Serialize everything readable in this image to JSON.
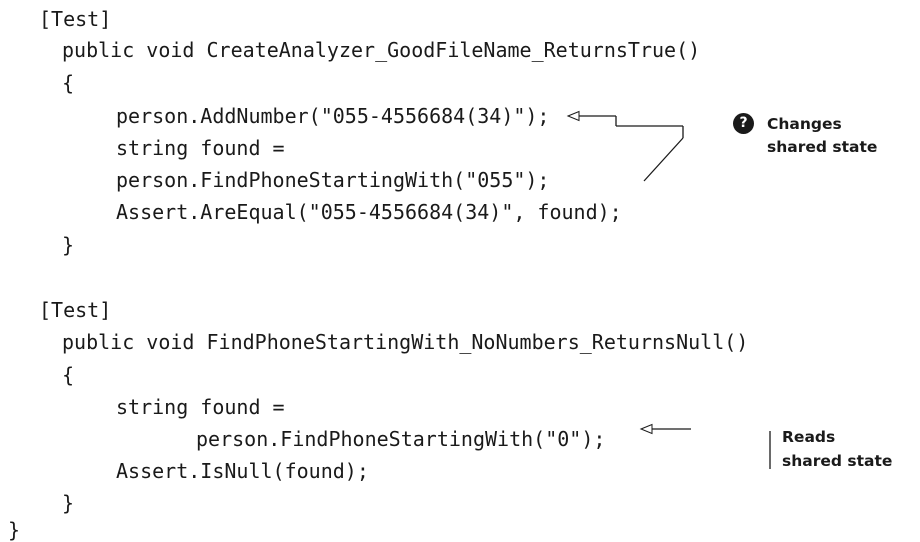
{
  "code": {
    "lines": [
      "[Test]",
      "public void CreateAnalyzer_GoodFileName_ReturnsTrue()",
      "{",
      "person.AddNumber(\"055-4556684(34)\");",
      "string found =",
      "person.FindPhoneStartingWith(\"055\");",
      "Assert.AreEqual(\"055-4556684(34)\", found);",
      "}",
      "[Test]",
      "public void FindPhoneStartingWith_NoNumbers_ReturnsNull()",
      "{",
      "string found =",
      "person.FindPhoneStartingWith(\"0\");",
      "Assert.IsNull(found);",
      "}",
      "}"
    ]
  },
  "annotations": {
    "changes": {
      "badge": "?",
      "line1": "Changes",
      "line2": "shared state"
    },
    "reads": {
      "line1": "Reads",
      "line2": "shared state"
    }
  }
}
